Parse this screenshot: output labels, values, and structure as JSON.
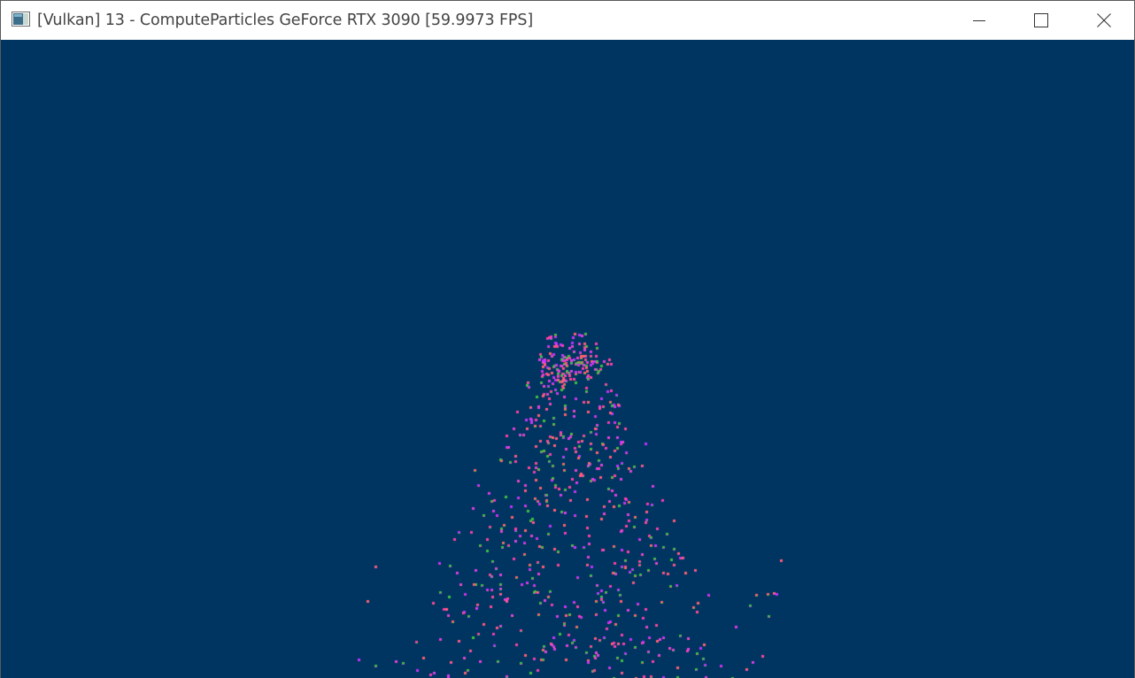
{
  "window": {
    "title": "[Vulkan] 13 - ComputeParticles GeForce RTX 3090 [59.9973 FPS]",
    "app_icon": "console-window-icon",
    "controls": {
      "minimize_icon": "minimize-icon",
      "maximize_icon": "maximize-icon",
      "close_icon": "close-icon"
    }
  },
  "viewport": {
    "background_color": "#003461",
    "content": "particle-simulation",
    "particle_colors": [
      "#e040e0",
      "#ff40a0",
      "#40c040",
      "#c030ff",
      "#ff6070"
    ],
    "particle_count_approx": 700
  },
  "colors": {
    "titlebar_bg": "#ffffff",
    "title_text": "#444444",
    "viewport_bg": "#003461"
  }
}
